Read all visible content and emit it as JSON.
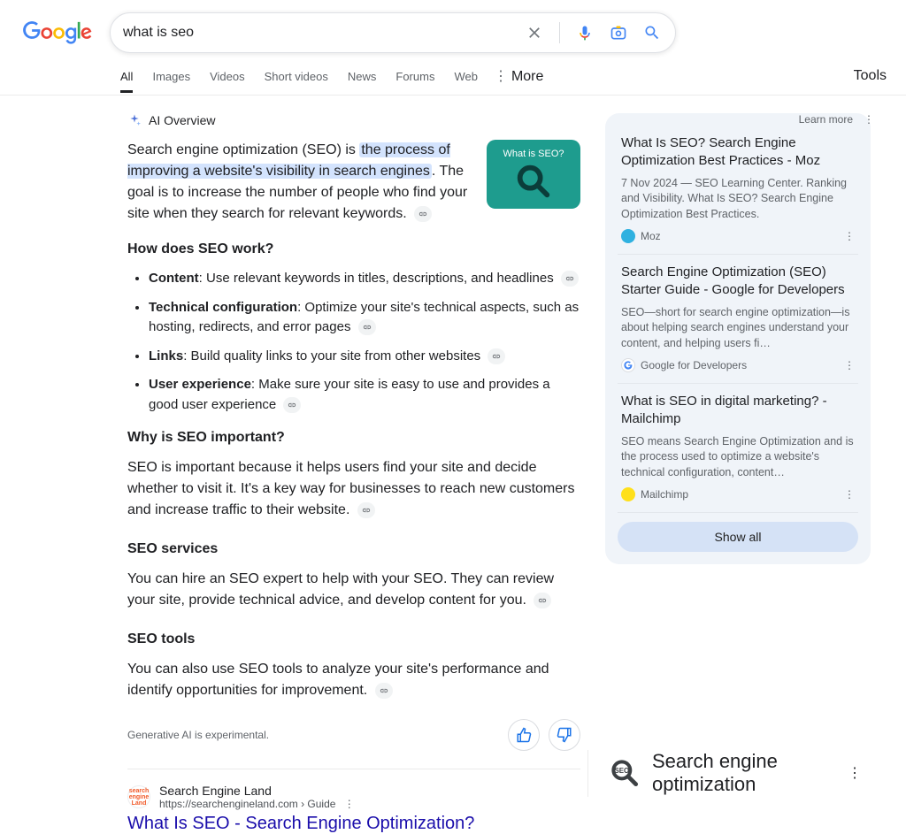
{
  "search": {
    "query": "what is seo"
  },
  "tabs": [
    "All",
    "Images",
    "Videos",
    "Short videos",
    "News",
    "Forums",
    "Web"
  ],
  "tabs_more": "More",
  "tabs_tools": "Tools",
  "learn_more": "Learn more",
  "ai": {
    "label": "AI Overview",
    "intro_prefix": "Search engine optimization (SEO) is ",
    "intro_highlight": "the process of improving a website's visibility in search engines",
    "intro_suffix": ". The goal is to increase the number of people who find your site when they search for relevant keywords.",
    "img_caption": "What is SEO?",
    "how_title": "How does SEO work?",
    "list": [
      {
        "b": "Content",
        "t": ": Use relevant keywords in titles, descriptions, and headlines"
      },
      {
        "b": "Technical configuration",
        "t": ": Optimize your site's technical aspects, such as hosting, redirects, and error pages"
      },
      {
        "b": "Links",
        "t": ": Build quality links to your site from other websites"
      },
      {
        "b": "User experience",
        "t": ": Make sure your site is easy to use and provides a good user experience"
      }
    ],
    "why_title": "Why is SEO important?",
    "why_text": "SEO is important because it helps users find your site and decide whether to visit it. It's a key way for businesses to reach new customers and increase traffic to their website.",
    "services_title": "SEO services",
    "services_text": "You can hire an SEO expert to help with your SEO. They can review your site, provide technical advice, and develop content for you.",
    "tools_title": "SEO tools",
    "tools_text": "You can also use SEO tools to analyze your site's performance and identify opportunities for improvement.",
    "experimental": "Generative AI is experimental."
  },
  "cards": [
    {
      "title": "What Is SEO? Search Engine Optimization Best Practices - Moz",
      "snippet": "7 Nov 2024 — SEO Learning Center. Ranking and Visibility. What Is SEO? Search Engine Optimization Best Practices.",
      "source": "Moz",
      "color": "#2fb1e0"
    },
    {
      "title": "Search Engine Optimization (SEO) Starter Guide - Google for Developers",
      "snippet": "SEO—short for search engine optimization—is about helping search engines understand your content, and helping users fi…",
      "source": "Google for Developers",
      "color": "#ffffff",
      "g": true
    },
    {
      "title": "What is SEO in digital marketing? - Mailchimp",
      "snippet": "SEO means Search Engine Optimization and is the process used to optimize a website's technical configuration, content…",
      "source": "Mailchimp",
      "color": "#ffe01b"
    }
  ],
  "show_all": "Show all",
  "result": {
    "site": "Search Engine Land",
    "url": "https://searchengineland.com › Guide",
    "title": "What Is SEO - Search Engine Optimization?"
  },
  "kp": {
    "title": "Search engine optimization"
  }
}
